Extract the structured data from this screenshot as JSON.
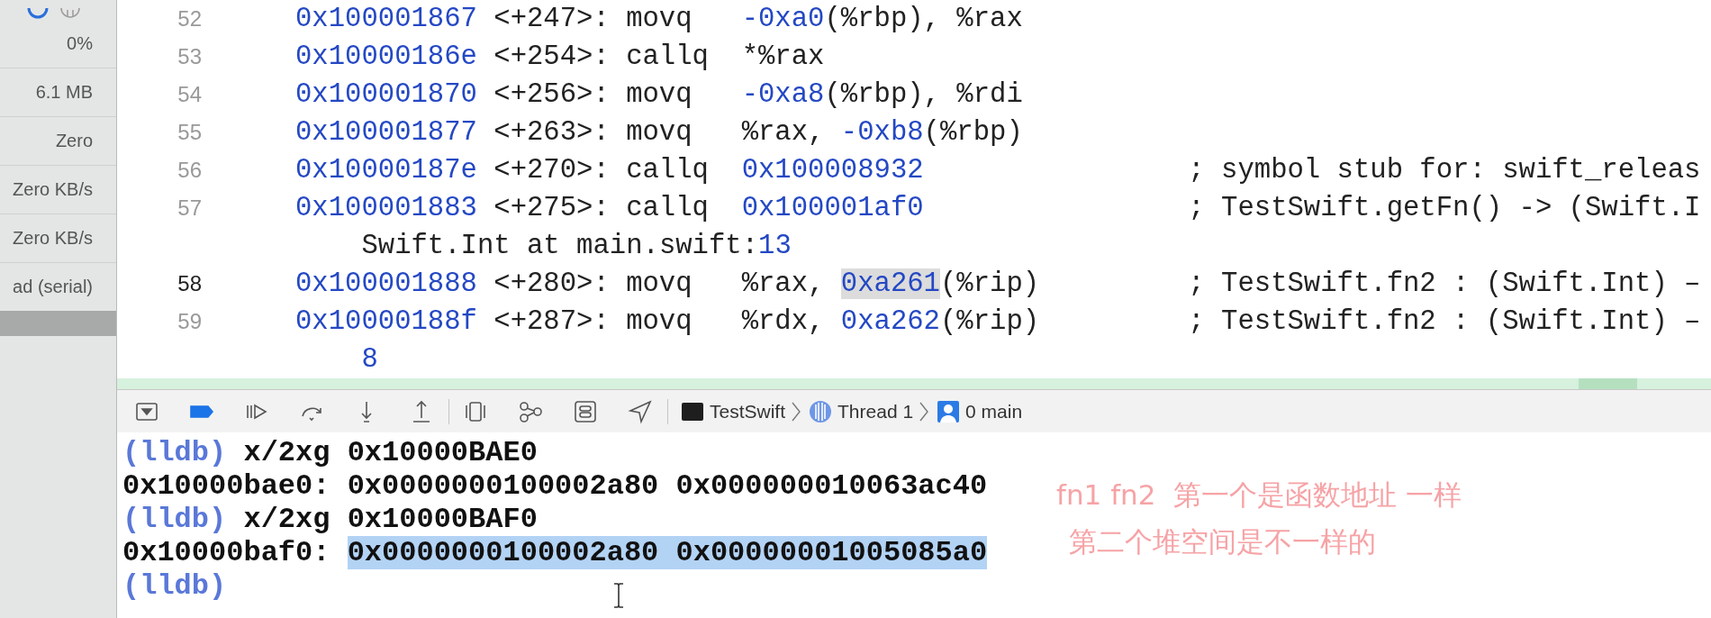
{
  "sidebar": {
    "values": [
      "0%",
      "6.1 MB",
      "Zero",
      "Zero KB/s",
      "Zero KB/s",
      "ad (serial)"
    ]
  },
  "disassembly": {
    "rows": [
      {
        "kind": "instruction",
        "line": "52",
        "current": false,
        "address": "0x100001867",
        "offset": "<+247>:",
        "mnemonic": "movq",
        "operands": [
          {
            "kind": "number",
            "text": "-0xa0"
          },
          {
            "kind": "text",
            "text": "(%rbp), %rax"
          }
        ]
      },
      {
        "kind": "instruction",
        "line": "53",
        "current": false,
        "address": "0x10000186e",
        "offset": "<+254>:",
        "mnemonic": "callq",
        "operands": [
          {
            "kind": "text",
            "text": "*%rax"
          }
        ]
      },
      {
        "kind": "instruction",
        "line": "54",
        "current": false,
        "address": "0x100001870",
        "offset": "<+256>:",
        "mnemonic": "movq",
        "operands": [
          {
            "kind": "number",
            "text": "-0xa8"
          },
          {
            "kind": "text",
            "text": "(%rbp), %rdi"
          }
        ]
      },
      {
        "kind": "instruction",
        "line": "55",
        "current": false,
        "address": "0x100001877",
        "offset": "<+263>:",
        "mnemonic": "movq",
        "operands": [
          {
            "kind": "text",
            "text": "%rax, "
          },
          {
            "kind": "number",
            "text": "-0xb8"
          },
          {
            "kind": "text",
            "text": "(%rbp)"
          }
        ]
      },
      {
        "kind": "instruction",
        "line": "56",
        "current": false,
        "address": "0x10000187e",
        "offset": "<+270>:",
        "mnemonic": "callq",
        "operands": [
          {
            "kind": "number",
            "text": "0x100008932"
          }
        ],
        "comment": "; symbol stub for: swift_releas"
      },
      {
        "kind": "instruction",
        "line": "57",
        "current": false,
        "address": "0x100001883",
        "offset": "<+275>:",
        "mnemonic": "callq",
        "operands": [
          {
            "kind": "number",
            "text": "0x100001af0"
          }
        ],
        "comment": "; TestSwift.getFn() -> (Swift.I"
      },
      {
        "kind": "continuation",
        "tokens": [
          {
            "kind": "text",
            "text": "Swift.Int at main.swift:"
          },
          {
            "kind": "number",
            "text": "13"
          }
        ]
      },
      {
        "kind": "instruction",
        "line": "58",
        "current": true,
        "address": "0x100001888",
        "offset": "<+280>:",
        "mnemonic": "movq",
        "operands": [
          {
            "kind": "text",
            "text": "%rax, "
          },
          {
            "kind": "match",
            "text": "0xa261"
          },
          {
            "kind": "text",
            "text": "(%rip)"
          }
        ],
        "comment": "; TestSwift.fn2 : (Swift.Int) –"
      },
      {
        "kind": "instruction",
        "line": "59",
        "current": false,
        "address": "0x10000188f",
        "offset": "<+287>:",
        "mnemonic": "movq",
        "operands": [
          {
            "kind": "text",
            "text": "%rdx, "
          },
          {
            "kind": "number",
            "text": "0xa262"
          },
          {
            "kind": "text",
            "text": "(%rip)"
          }
        ],
        "comment": "; TestSwift.fn2 : (Swift.Int) –"
      },
      {
        "kind": "continuation",
        "tokens": [
          {
            "kind": "number",
            "text": "8"
          }
        ]
      }
    ]
  },
  "debug_bar": {
    "breakpoints_active": true,
    "breadcrumbs": [
      {
        "kind": "process",
        "label": "TestSwift"
      },
      {
        "kind": "thread",
        "label": "Thread 1"
      },
      {
        "kind": "frame",
        "label": "0 main"
      }
    ]
  },
  "console": {
    "lines": [
      {
        "kind": "command",
        "prompt": "(lldb)",
        "command": "x/2xg 0x10000BAE0"
      },
      {
        "kind": "output",
        "address": "0x10000bae0:",
        "values": "0x0000000100002a80 0x000000010063ac40",
        "selected": false
      },
      {
        "kind": "command",
        "prompt": "(lldb)",
        "command": "x/2xg 0x10000BAF0"
      },
      {
        "kind": "output",
        "address": "0x10000baf0:",
        "values": "0x0000000100002a80 0x00000001005085a0",
        "selected": true
      },
      {
        "kind": "command",
        "prompt": "(lldb)"
      }
    ]
  },
  "annotation": {
    "lines": [
      "fn1 fn2  第一个是函数地址 一样",
      "第二个堆空间是不一样的"
    ]
  }
}
